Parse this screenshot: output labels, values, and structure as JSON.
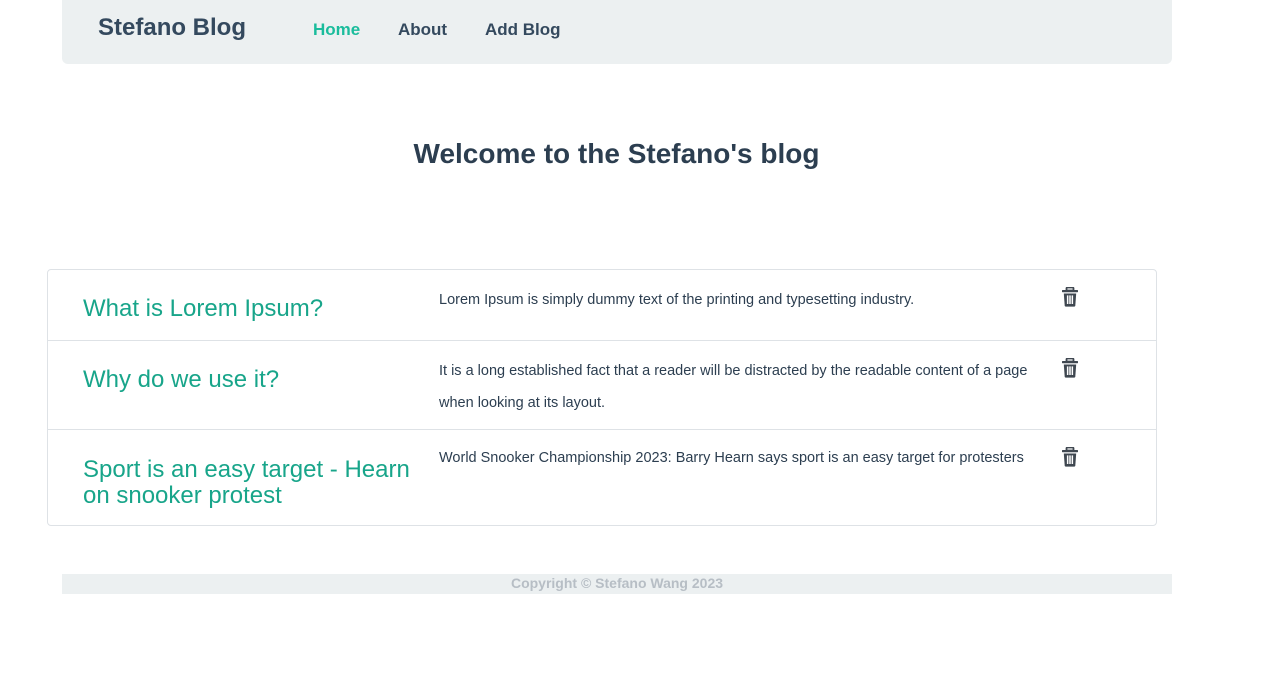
{
  "navbar": {
    "brand": "Stefano Blog",
    "links": [
      {
        "label": "Home",
        "active": true
      },
      {
        "label": "About",
        "active": false
      },
      {
        "label": "Add Blog",
        "active": false
      }
    ]
  },
  "main": {
    "title": "Welcome to the Stefano's blog"
  },
  "blogs": [
    {
      "title": "What is Lorem Ipsum?",
      "description": "Lorem Ipsum is simply dummy text of the printing and typesetting industry.",
      "action_icon": "trash-icon"
    },
    {
      "title": "Why do we use it?",
      "description": "It is a long established fact that a reader will be distracted by the readable content of a page when looking at its layout.",
      "action_icon": "trash-icon"
    },
    {
      "title": "Sport is an easy target - Hearn on snooker protest",
      "description": "World Snooker Championship 2023: Barry Hearn says sport is an easy target for protesters",
      "action_icon": "trash-icon"
    }
  ],
  "footer": {
    "copyright": "Copyright © Stefano Wang 2023"
  },
  "colors": {
    "accent": "#1abc9c",
    "navbar_bg": "#ecf0f1",
    "text": "#2c3e50"
  }
}
